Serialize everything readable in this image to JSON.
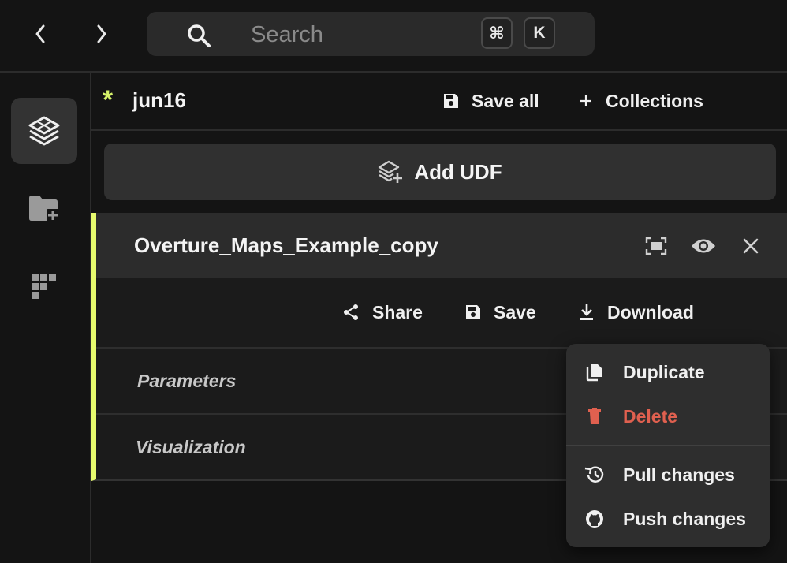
{
  "nav": {
    "back_icon": "chevron-left-icon",
    "forward_icon": "chevron-right-icon"
  },
  "search": {
    "placeholder": "Search",
    "value": "",
    "shortcut_keys": [
      "⌘",
      "K"
    ]
  },
  "rail": {
    "items": [
      "layers-icon",
      "folder-add-icon",
      "grid-blocks-icon"
    ]
  },
  "header": {
    "project_marker": "*",
    "project_name": "jun16",
    "save_all_label": "Save all",
    "collections_label": "Collections"
  },
  "add_udf": {
    "label": "Add UDF"
  },
  "udf": {
    "title": "Overture_Maps_Example_copy",
    "share_label": "Share",
    "save_label": "Save",
    "download_label": "Download",
    "sections": [
      "Parameters",
      "Visualization"
    ]
  },
  "menu": {
    "items": [
      "Duplicate",
      "Delete",
      "Pull changes",
      "Push changes"
    ]
  },
  "colors": {
    "accent": "#e7fb6e",
    "danger": "#e0604f",
    "background": "#141414"
  }
}
